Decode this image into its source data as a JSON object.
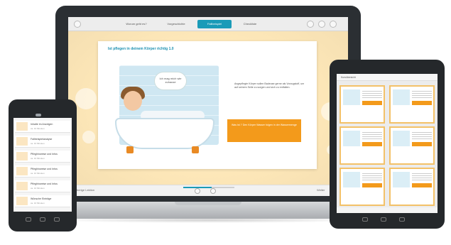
{
  "laptop": {
    "toolbar": {
      "tabs": [
        {
          "label": "Worum geht es?",
          "active": false
        },
        {
          "label": "Vorgeschichte",
          "active": false
        },
        {
          "label": "Fallbeispiel",
          "active": true
        },
        {
          "label": "Checkliste",
          "active": false
        }
      ]
    },
    "card": {
      "title": "Ist pflegen in deinem Körper richtig 1.0",
      "speech": "Ich mag mich wie zuhause",
      "body": "Angepflegte Körper sollen Badeuse gerne als Vorzugstoff, um auf seinem Seite zu sorgen und sich zu entfalten.",
      "cta": "Was ist ? Den Körper Wasser folgen in der Wassermenge"
    },
    "bottom_bar": {
      "left_label": "Vorherige Lektion",
      "right_label": "Weiter",
      "progress": 0.55
    }
  },
  "phone": {
    "items": [
      {
        "title": "Inhalte im Anzeigen",
        "sub": "ca. 10 Minuten"
      },
      {
        "title": "Fallbeispielanalyse",
        "sub": "ca. 10 Minuten"
      },
      {
        "title": "Pfleghinweise und Infos",
        "sub": "ca. 10 Minuten"
      },
      {
        "title": "Pfleghinweise und Infos",
        "sub": "ca. 10 Minuten"
      },
      {
        "title": "Pfleghinweise und Infos",
        "sub": "ca. 10 Minuten"
      },
      {
        "title": "Wünsche Einträge",
        "sub": "ca. 10 Minuten"
      }
    ]
  },
  "tablet": {
    "title": "Kursübersicht"
  },
  "colors": {
    "accent": "#1a9bb8",
    "cta": "#f39a1b",
    "card_border": "#f3c168"
  }
}
